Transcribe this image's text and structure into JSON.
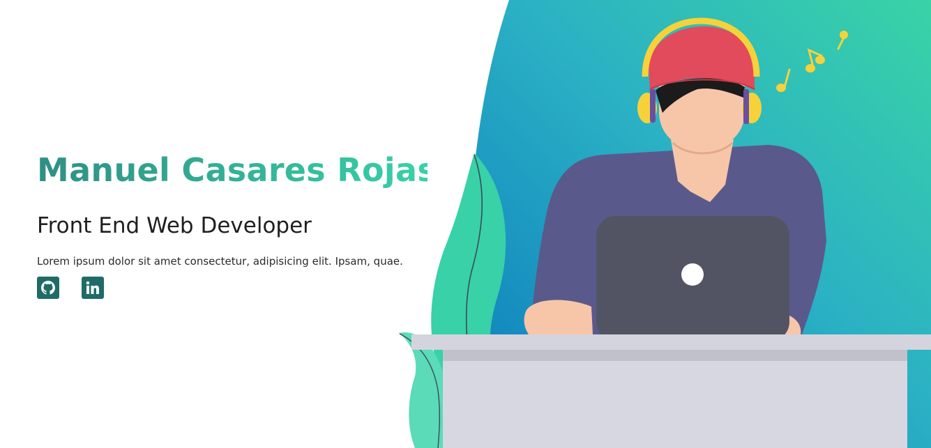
{
  "hero": {
    "name": "Manuel Casares Rojas",
    "role": "Front End Web Developer",
    "blurb": "Lorem ipsum dolor sit amet consectetur, adipisicing elit. Ipsam, quae."
  },
  "socials": [
    {
      "icon": "github-icon",
      "label": "GitHub"
    },
    {
      "icon": "linkedin-icon",
      "label": "LinkedIn"
    }
  ],
  "colors": {
    "name_gradient_start": "#2f8f84",
    "name_gradient_end": "#38d1a8",
    "social_bg": "#1f6b67",
    "blob_start": "#0a7bbd",
    "blob_end": "#39d3a6"
  }
}
